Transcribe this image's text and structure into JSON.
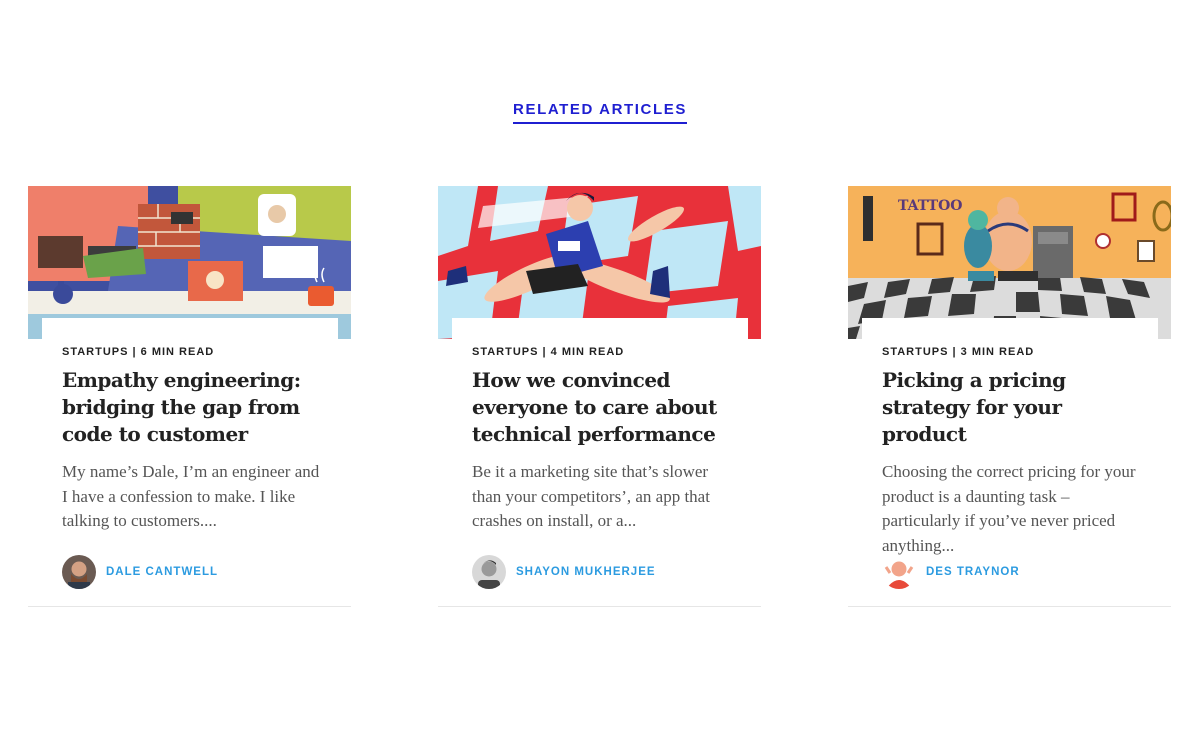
{
  "section": {
    "title": "RELATED ARTICLES"
  },
  "colors": {
    "link": "#1f1fd1",
    "author": "#2c9be0",
    "text": "#222222",
    "excerpt": "#555555"
  },
  "articles": [
    {
      "meta": "STARTUPS | 6 MIN READ",
      "title": "Empathy engineering: bridging the gap from code to customer",
      "excerpt": "My name’s Dale, I’m an engineer and I have a confession to make. I like talking to customers....",
      "author": "DALE CANTWELL",
      "image": "illustration-office-scene"
    },
    {
      "meta": "STARTUPS | 4 MIN READ",
      "title": "How we convinced everyone to care about technical performance",
      "excerpt": "Be it a marketing site that’s slower than your competitors’, an app that crashes on install, or a...",
      "author": "SHAYON MUKHERJEE",
      "image": "illustration-hurdler"
    },
    {
      "meta": "STARTUPS | 3 MIN READ",
      "title": "Picking a pricing strategy for your product",
      "excerpt": "Choosing the correct pricing for your product is a daunting task – particularly if you’ve never priced anything...",
      "author": "DES TRAYNOR",
      "image": "illustration-tattoo-parlour"
    }
  ]
}
